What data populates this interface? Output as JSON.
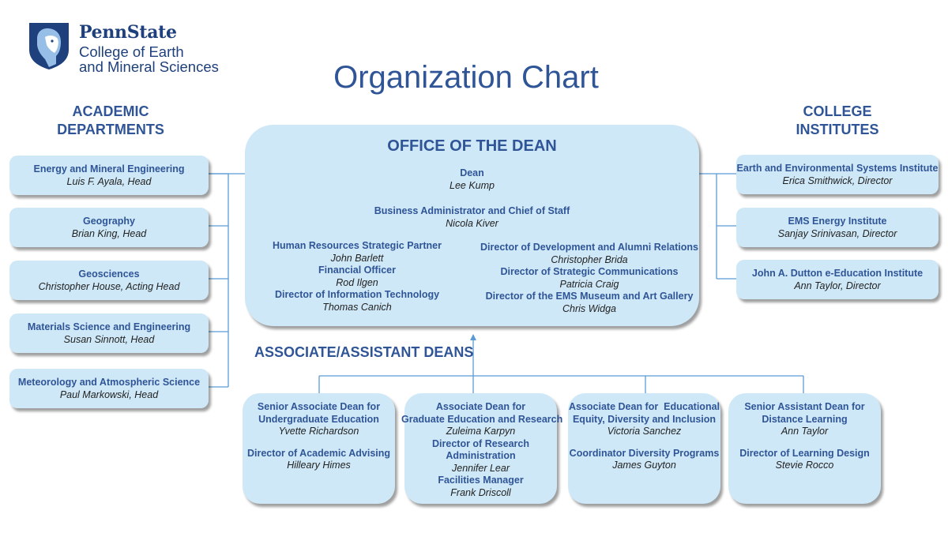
{
  "logo": {
    "icon": "nittany-lion-shield-icon",
    "brand": "PennState",
    "college_line1": "College of Earth",
    "college_line2": "and Mineral Sciences"
  },
  "title": "Organization Chart",
  "colors": {
    "heading": "#2f5597",
    "box_fill": "#cfe8f7",
    "connector": "#5b9bd5",
    "logo": "#1e407c"
  },
  "academic_departments": {
    "heading_line1": "ACADEMIC",
    "heading_line2": "DEPARTMENTS",
    "items": [
      {
        "title": "Energy and Mineral Engineering",
        "name": "Luis F. Ayala, Head"
      },
      {
        "title": "Geography",
        "name": "Brian King, Head"
      },
      {
        "title": "Geosciences",
        "name": "Christopher House, Acting Head"
      },
      {
        "title": "Materials Science and Engineering",
        "name": "Susan Sinnott, Head"
      },
      {
        "title": "Meteorology and Atmospheric Science",
        "name": "Paul Markowski, Head"
      }
    ]
  },
  "college_institutes": {
    "heading_line1": "COLLEGE",
    "heading_line2": "INSTITUTES",
    "items": [
      {
        "title": "Earth and Environmental Systems Institute",
        "name": "Erica Smithwick, Director"
      },
      {
        "title": "EMS Energy Institute",
        "name": "Sanjay Srinivasan, Director"
      },
      {
        "title": "John A. Dutton e-Education Institute",
        "name": "Ann Taylor, Director"
      }
    ]
  },
  "office_of_dean": {
    "heading": "OFFICE OF THE DEAN",
    "dean": {
      "title": "Dean",
      "name": "Lee Kump"
    },
    "chief_of_staff": {
      "title": "Business Administrator and Chief of Staff",
      "name": "Nicola Kiver"
    },
    "left_column": [
      {
        "title": "Human Resources Strategic Partner",
        "name": "John Barlett"
      },
      {
        "title": "Financial Officer",
        "name": "Rod Ilgen"
      },
      {
        "title": "Director of Information Technology",
        "name": "Thomas Canich"
      }
    ],
    "right_column": [
      {
        "title": "Director of Development and Alumni Relations",
        "name": "Christopher Brida"
      },
      {
        "title": "Director of Strategic Communications",
        "name": "Patricia Craig"
      },
      {
        "title": "Director of the EMS Museum and Art Gallery",
        "name": "Chris Widga"
      }
    ]
  },
  "associate_deans": {
    "heading": "ASSOCIATE/ASSISTANT DEANS",
    "boxes": [
      {
        "title_line1": "Senior Associate Dean for",
        "title_line2": "Undergraduate Education",
        "name": "Yvette Richardson",
        "sub_title": "Director of Academic Advising",
        "sub_name": "Hilleary Himes"
      },
      {
        "title_line1": "Associate Dean for",
        "title_line2": "Graduate Education and Research",
        "name": "Zuleima Karpyn",
        "sub_title_line1": "Director of Research",
        "sub_title_line2": "Administration",
        "sub_name": "Jennifer Lear",
        "sub2_title": "Facilities Manager",
        "sub2_name": "Frank Driscoll"
      },
      {
        "title_line1": "Associate Dean for  Educational",
        "title_line2": "Equity, Diversity and Inclusion",
        "name": "Victoria Sanchez",
        "sub_title": "Coordinator Diversity Programs",
        "sub_name": "James Guyton"
      },
      {
        "title_line1": "Senior Assistant Dean for",
        "title_line2": "Distance Learning",
        "name": "Ann Taylor",
        "sub_title": "Director of Learning Design",
        "sub_name": "Stevie Rocco"
      }
    ]
  }
}
